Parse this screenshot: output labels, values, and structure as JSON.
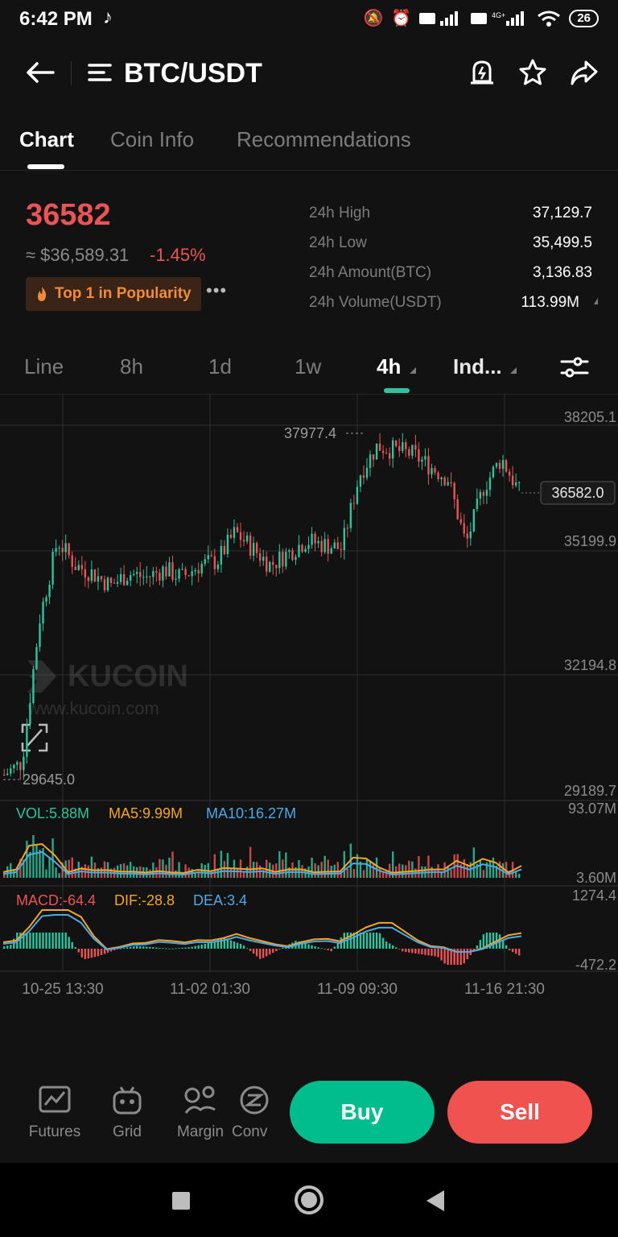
{
  "status": {
    "time": "6:42 PM",
    "battery": "26",
    "network": "4G+"
  },
  "header": {
    "pair": "BTC/USDT"
  },
  "tabs": [
    {
      "label": "Chart",
      "active": true
    },
    {
      "label": "Coin Info"
    },
    {
      "label": "Recommendations"
    }
  ],
  "price": {
    "last": "36582",
    "usd": "≈ $36,589.31",
    "change": "-1.45%",
    "badge": "Top 1 in Popularity"
  },
  "stats": [
    {
      "label": "24h High",
      "value": "37,129.7"
    },
    {
      "label": "24h Low",
      "value": "35,499.5"
    },
    {
      "label": "24h Amount(BTC)",
      "value": "3,136.83"
    },
    {
      "label": "24h Volume(USDT)",
      "value": "113.99M"
    }
  ],
  "intervals": [
    {
      "label": "Line"
    },
    {
      "label": "8h"
    },
    {
      "label": "1d"
    },
    {
      "label": "1w"
    },
    {
      "label": "4h",
      "active": true
    },
    {
      "label": "Ind..."
    }
  ],
  "chart": {
    "y_ticks": [
      "38205.1",
      "35199.9",
      "32194.8",
      "29189.7"
    ],
    "max_label": "37977.4",
    "min_label": "29645.0",
    "current_label": "36582.0",
    "watermark": "KUCOIN",
    "watermark_url": "www.kucoin.com",
    "vol_label": "VOL:5.88M",
    "ma5_label": "MA5:9.99M",
    "ma10_label": "MA10:16.27M",
    "vol_max": "93.07M",
    "vol_min": "3.60M",
    "macd_label": "MACD:-64.4",
    "dif_label": "DIF:-28.8",
    "dea_label": "DEA:3.4",
    "macd_max": "1274.4",
    "macd_min": "-472.2",
    "x_ticks": [
      "10-25 13:30",
      "11-02 01:30",
      "11-09 09:30",
      "11-16 21:30"
    ]
  },
  "chart_data": {
    "type": "candlestick",
    "x_ticks": [
      "10-25 13:30",
      "11-02 01:30",
      "11-09 09:30",
      "11-16 21:30"
    ],
    "ylim": [
      29189.7,
      38205.1
    ],
    "close_path": [
      29700,
      30000,
      33500,
      35400,
      34800,
      34600,
      34300,
      34600,
      34500,
      34700,
      34500,
      34800,
      34900,
      35600,
      35200,
      34800,
      35100,
      35400,
      35300,
      35200,
      37000,
      37700,
      37600,
      37500,
      37200,
      36900,
      35300,
      36700,
      37400,
      36582
    ],
    "colors": {
      "up": "#2ec4a0",
      "down": "#ea5455",
      "ma5": "#f5a623",
      "ma10": "#4fa8e8"
    }
  },
  "bottom_nav": [
    {
      "label": "Futures"
    },
    {
      "label": "Grid"
    },
    {
      "label": "Margin"
    },
    {
      "label": "Conv"
    }
  ],
  "actions": {
    "buy": "Buy",
    "sell": "Sell"
  }
}
